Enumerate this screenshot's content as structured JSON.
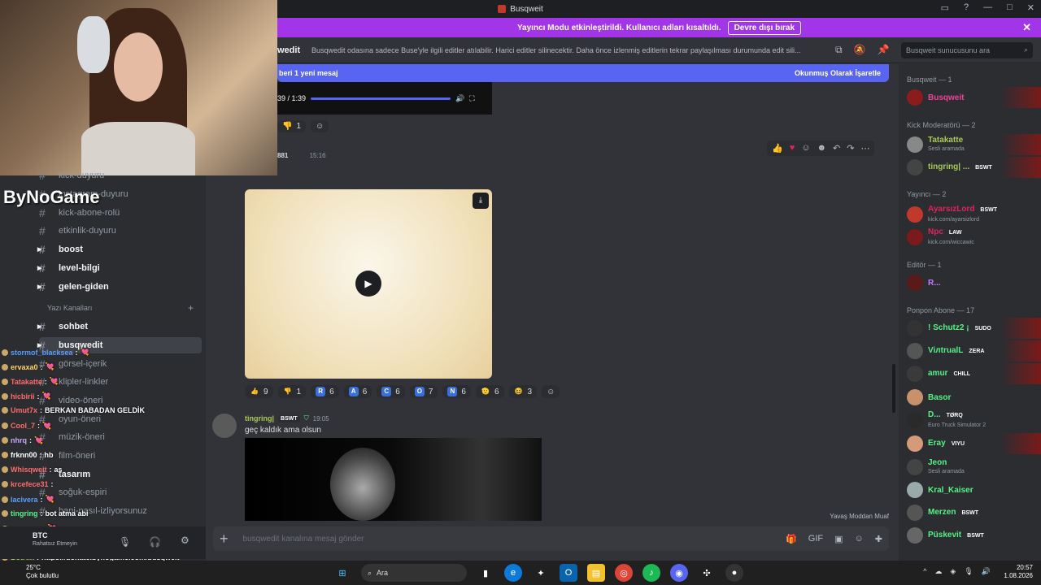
{
  "window": {
    "title": "Busqweit"
  },
  "banner": {
    "text": "Yayıncı Modu etkinleştirildi. Kullanıcı adları kısaltıldı.",
    "button": "Devre dışı bırak"
  },
  "channel_header": {
    "name": "wedit",
    "topic": "Busqwedit odasına sadece Buse'yle ilgili editler atılabilir. Harici editler silinecektir. Daha önce izlenmiş editlerin tekrar paylaşılması durumunda edit sili...",
    "search_placeholder": "Busqweit sunucusunu ara"
  },
  "new_messages": {
    "text": "beri 1 yeni mesaj",
    "mark_read": "Okunmuş Olarak İşaretle"
  },
  "player": {
    "time": "39 / 1:39"
  },
  "top_reactions": [
    {
      "emoji": "👎",
      "count": "1"
    }
  ],
  "message1": {
    "author": "881",
    "time": "15:16"
  },
  "reactions1": [
    {
      "emoji": "👍",
      "count": "9",
      "color": ""
    },
    {
      "emoji": "👎",
      "count": "1",
      "color": ""
    },
    {
      "emoji": "R",
      "count": "6",
      "color": "#3a6fd8"
    },
    {
      "emoji": "A",
      "count": "6",
      "color": "#3a6fd8"
    },
    {
      "emoji": "C",
      "count": "6",
      "color": "#3a6fd8"
    },
    {
      "emoji": "O",
      "count": "7",
      "color": "#3a6fd8"
    },
    {
      "emoji": "N",
      "count": "6",
      "color": "#3a6fd8"
    },
    {
      "emoji": "🫡",
      "count": "6",
      "color": ""
    },
    {
      "emoji": "😆",
      "count": "3",
      "color": ""
    }
  ],
  "message2": {
    "author": "tingring|",
    "badge": "BSWT",
    "time": "19:05",
    "text": "geç kaldık ama olsun"
  },
  "slow_mode": "Yavaş Moddan Muaf",
  "input": {
    "placeholder": "busqwedit kanalına mesaj gönder"
  },
  "sidebar": {
    "category": "Yazı Kanalları",
    "channels": [
      {
        "label": "kick-duyuru"
      },
      {
        "label": "instagram-duyuru"
      },
      {
        "label": "kick-abone-rolü"
      },
      {
        "label": "etkinlik-duyuru"
      },
      {
        "label": "boost"
      },
      {
        "label": "level-bilgi"
      },
      {
        "label": "gelen-giden"
      },
      {
        "label": "sohbet"
      },
      {
        "label": "busqwedit"
      },
      {
        "label": "görsel-içerik"
      },
      {
        "label": "klipler-linkler"
      },
      {
        "label": "video-öneri"
      },
      {
        "label": "oyun-öneri"
      },
      {
        "label": "müzik-öneri"
      },
      {
        "label": "film-öneri"
      },
      {
        "label": "tasarım"
      },
      {
        "label": "soğuk-espiri"
      },
      {
        "label": "hani-nasıl-izliyorsunuz"
      }
    ],
    "user": {
      "name": "BTC",
      "status": "Rahatsız Etmeyin"
    }
  },
  "brand": "ByNoGame",
  "chat_overlay": [
    {
      "user": "stormof_blacksea",
      "msg": "💘"
    },
    {
      "user": "ervaxa0",
      "msg": "💘"
    },
    {
      "user": "Tatakatte",
      "msg": "💘"
    },
    {
      "user": "hicbirii",
      "msg": "💘"
    },
    {
      "user": "Umut7x",
      "msg": "BERKAN BABADAN GELDİK"
    },
    {
      "user": "Cool_7",
      "msg": "💘"
    },
    {
      "user": "nhrq",
      "msg": "💘"
    },
    {
      "user": "frknn00",
      "msg": "hb"
    },
    {
      "user": "Whisqweit",
      "msg": "as"
    },
    {
      "user": "krcefece31",
      "msg": ""
    },
    {
      "user": "lacivera",
      "msg": "💘"
    },
    {
      "user": "tingring",
      "msg": "bot atma abi"
    },
    {
      "user": "yengaan",
      "msg": "💘"
    },
    {
      "user": "Tatakatte",
      "msg": "💘"
    },
    {
      "user": "BotRix",
      "msg": "https://donate.bynogame.com/busqweit"
    }
  ],
  "members": {
    "groups": [
      {
        "label": "Busqweit — 1"
      },
      {
        "label": "Kick Moderatörü — 2"
      },
      {
        "label": "Yayıncı — 2"
      },
      {
        "label": "Editör — 1"
      },
      {
        "label": "Ponpon Abone — 17"
      }
    ],
    "list": [
      {
        "name": "Busqweit",
        "sub": "",
        "badge": "",
        "color": "#f23f98"
      },
      {
        "name": "Tatakatte",
        "sub": "Sesli aramada",
        "badge": "",
        "color": "#a7c957"
      },
      {
        "name": "tingring| ...",
        "sub": "",
        "badge": "BSWT",
        "color": "#a7c957"
      },
      {
        "name": "AyarsızLord",
        "sub": "kick.com/ayarsizlord",
        "badge": "BSWT",
        "color": "#e0245e"
      },
      {
        "name": "Npc",
        "sub": "kick.com/wiccawic",
        "badge": "LAW",
        "color": "#e0245e"
      },
      {
        "name": "R...",
        "sub": "",
        "badge": "",
        "color": "#c77dff"
      },
      {
        "name": "! Sсhutz2 ¡",
        "sub": "",
        "badge": "SUDO",
        "color": "#57f287"
      },
      {
        "name": "ViлtrualL",
        "sub": "",
        "badge": "ZERA",
        "color": "#57f287"
      },
      {
        "name": "amur",
        "sub": "",
        "badge": "CHILL",
        "color": "#57f287"
      },
      {
        "name": "Basor",
        "sub": "",
        "badge": "",
        "color": "#57f287"
      },
      {
        "name": "D...",
        "sub": "Euro Truck Simulator 2",
        "badge": "TØRQ",
        "color": "#57f287"
      },
      {
        "name": "Eray",
        "sub": "",
        "badge": "VIYU",
        "color": "#57f287"
      },
      {
        "name": "Jeon",
        "sub": "Sesli aramada",
        "badge": "",
        "color": "#57f287"
      },
      {
        "name": "Kral_Kaiser",
        "sub": "",
        "badge": "",
        "color": "#57f287"
      },
      {
        "name": "Merzen",
        "sub": "",
        "badge": "BSWT",
        "color": "#57f287"
      },
      {
        "name": "Püskevit",
        "sub": "",
        "badge": "BSWT",
        "color": "#57f287"
      }
    ]
  },
  "taskbar": {
    "temp": "25°C",
    "weather": "Çok bulutlu",
    "search": "Ara",
    "time": "20:57",
    "date": "1.08.2026"
  }
}
